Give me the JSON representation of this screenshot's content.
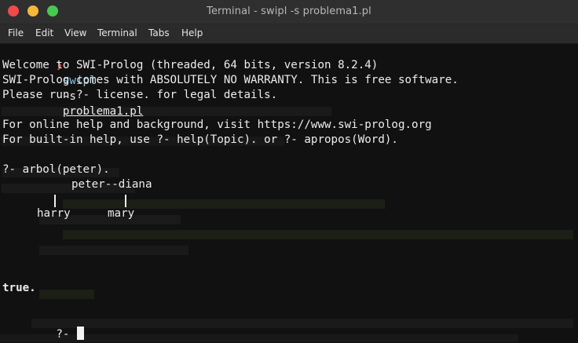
{
  "window": {
    "title": "Terminal - swipl -s problema1.pl"
  },
  "menu": [
    "File",
    "Edit",
    "View",
    "Terminal",
    "Tabs",
    "Help"
  ],
  "terminal": {
    "prompt_symbol": "❯",
    "command_name": "swipl",
    "command_flag": "-s",
    "command_file": "problema1.pl",
    "welcome_1": "Welcome to SWI-Prolog (threaded, 64 bits, version 8.2.4)",
    "welcome_2": "SWI-Prolog comes with ABSOLUTELY NO WARRANTY. This is free software.",
    "welcome_3": "Please run ?- license. for legal details.",
    "help_1": "For online help and background, visit https://www.swi-prolog.org",
    "help_2": "For built-in help, use ?- help(Topic). or ?- apropos(Word).",
    "query": "?- arbol(peter).",
    "tree_parents": "peter--diana",
    "tree_child_1": "harry",
    "tree_child_2": "mary",
    "result": "true.",
    "final_prompt": "?- "
  }
}
